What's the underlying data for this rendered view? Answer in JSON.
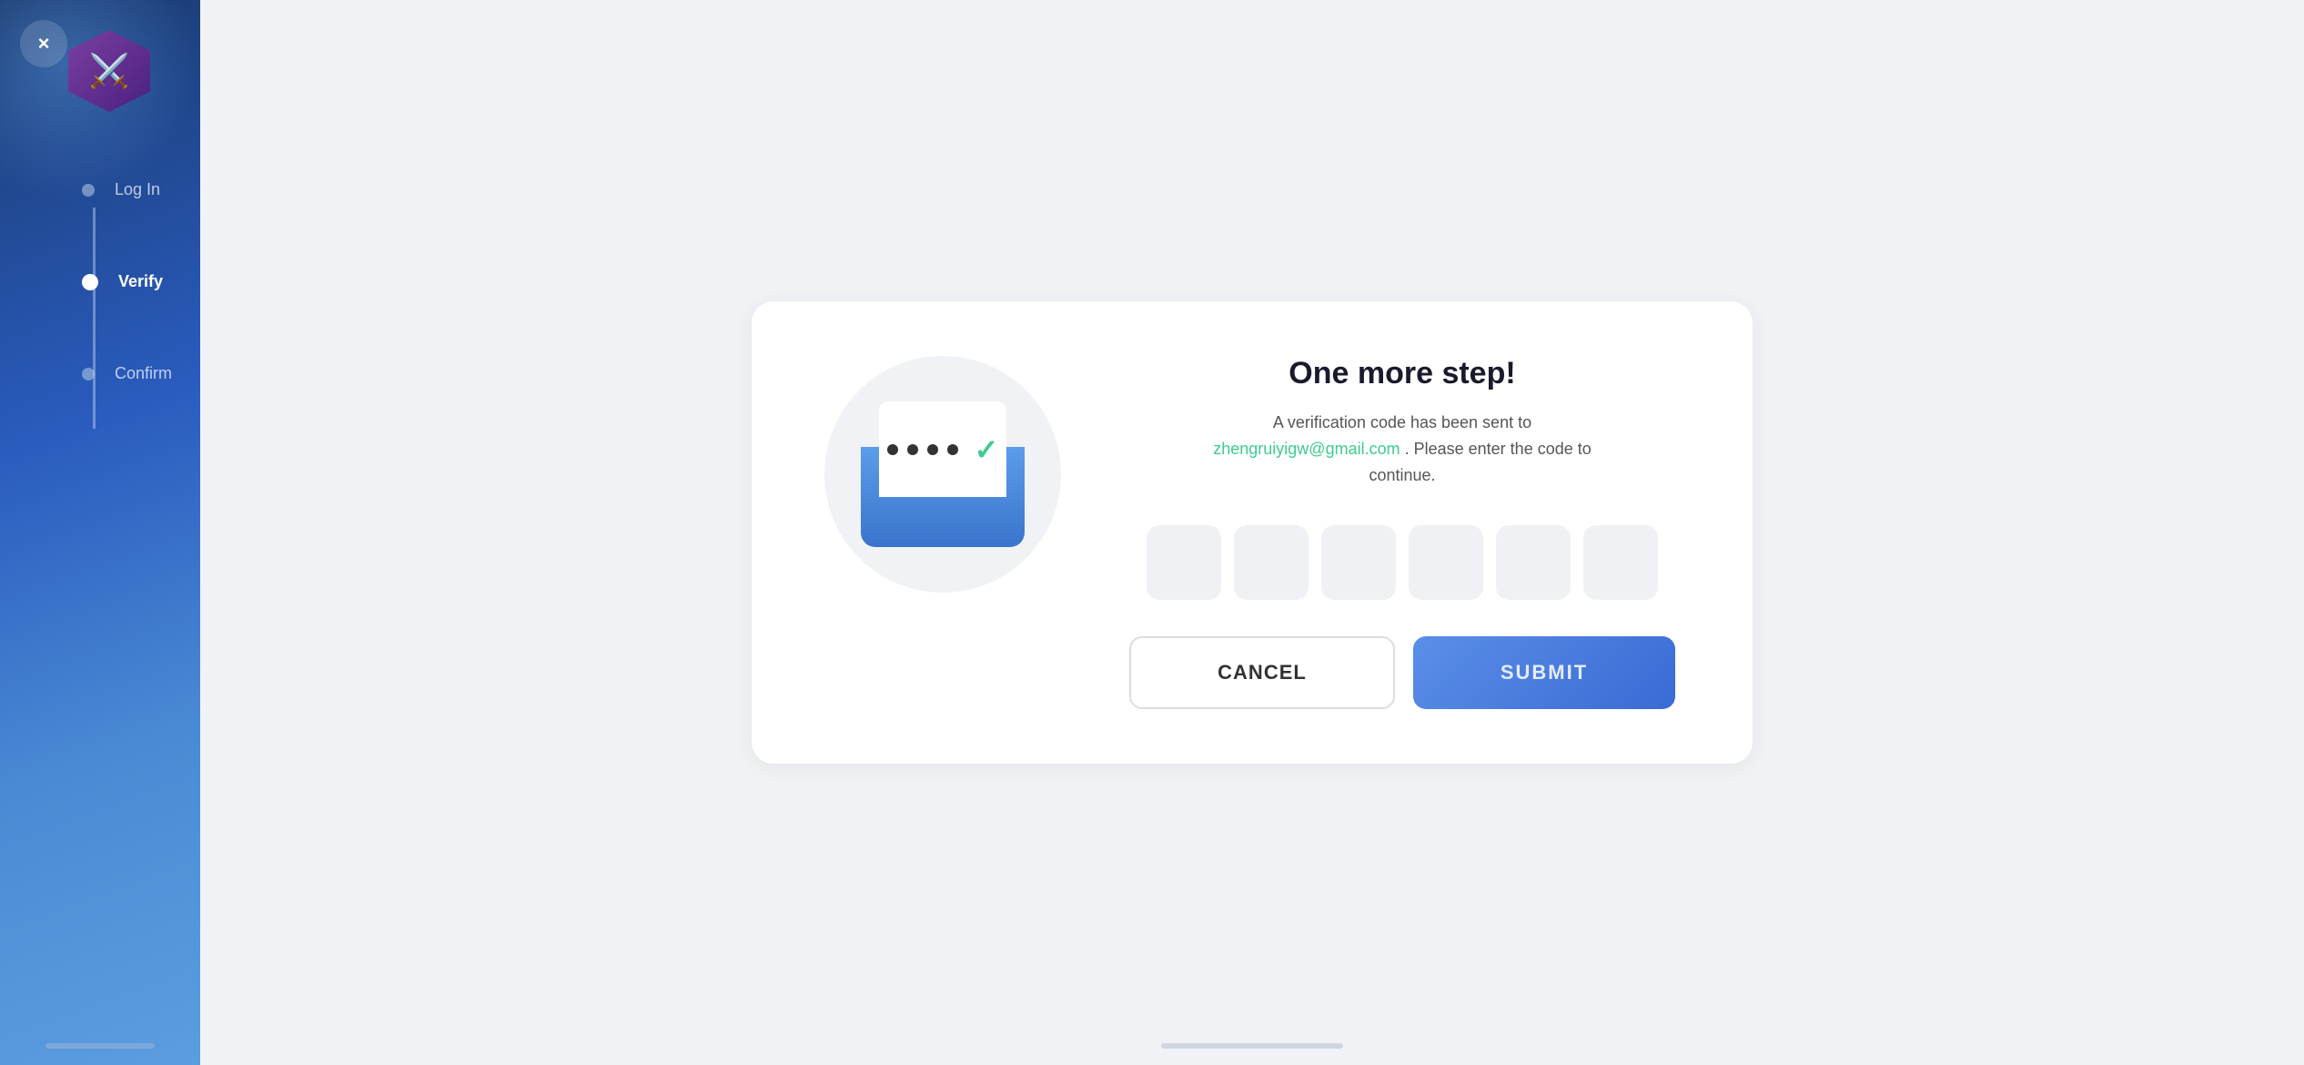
{
  "sidebar": {
    "close_label": "×",
    "steps": [
      {
        "id": "login",
        "label": "Log In",
        "active": false
      },
      {
        "id": "verify",
        "label": "Verify",
        "active": true
      },
      {
        "id": "confirm",
        "label": "Confirm",
        "active": false
      }
    ]
  },
  "verify": {
    "title": "One more step!",
    "subtitle_prefix": "A verification code has been sent to",
    "email": "zhengruiyigw@gmail.com",
    "subtitle_suffix": ". Please enter the code to continue.",
    "code_placeholder": "",
    "cancel_label": "CANCEL",
    "submit_label": "SUBMIT",
    "code_boxes": 6
  }
}
